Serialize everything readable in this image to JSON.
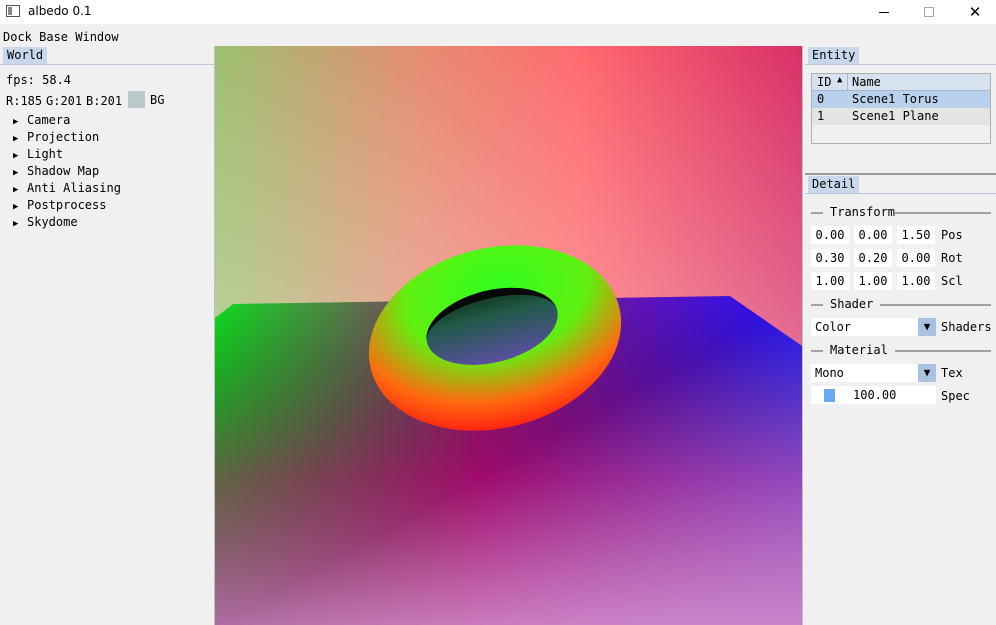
{
  "window": {
    "title": "albedo 0.1",
    "close_glyph": "✕"
  },
  "menu": {
    "items": [
      "Dock Base Window"
    ]
  },
  "world": {
    "tab": "World",
    "fps": "fps: 58.4",
    "r": "R:185",
    "g": "G:201",
    "b": "B:201",
    "bg_color": "#b9c9c9",
    "bg_label": "BG",
    "tree_arrow": "▶",
    "tree": [
      "Camera",
      "Projection",
      "Light",
      "Shadow Map",
      "Anti Aliasing",
      "Postprocess",
      "Skydome"
    ]
  },
  "viewport": {
    "objects": [
      "torus",
      "plane"
    ]
  },
  "entity": {
    "tab": "Entity",
    "columns": [
      "ID",
      "Name"
    ],
    "sort_glyph": "▲",
    "rows": [
      {
        "id": "0",
        "name": "Scene1 Torus",
        "selected": true
      },
      {
        "id": "1",
        "name": "Scene1 Plane",
        "selected": false
      }
    ]
  },
  "detail": {
    "tab": "Detail",
    "transform": {
      "title": "Transform",
      "pos": [
        "0.00",
        "0.00",
        "1.50"
      ],
      "rot": [
        "0.30",
        "0.20",
        "0.00"
      ],
      "scl": [
        "1.00",
        "1.00",
        "1.00"
      ],
      "pos_label": "Pos",
      "rot_label": "Rot",
      "scl_label": "Scl"
    },
    "shader": {
      "title": "Shader",
      "value": "Color",
      "label": "Shaders"
    },
    "material": {
      "title": "Material",
      "tex_value": "Mono",
      "tex_label": "Tex",
      "spec_value": "100.00",
      "spec_label": "Spec"
    },
    "combo_arrow": "▼"
  },
  "colors": {
    "tab_bg": "#c8d8ec",
    "selected_row": "#b9d1ec",
    "combo_button": "#a9c2df",
    "spec_grab": "#6aa8f0"
  }
}
